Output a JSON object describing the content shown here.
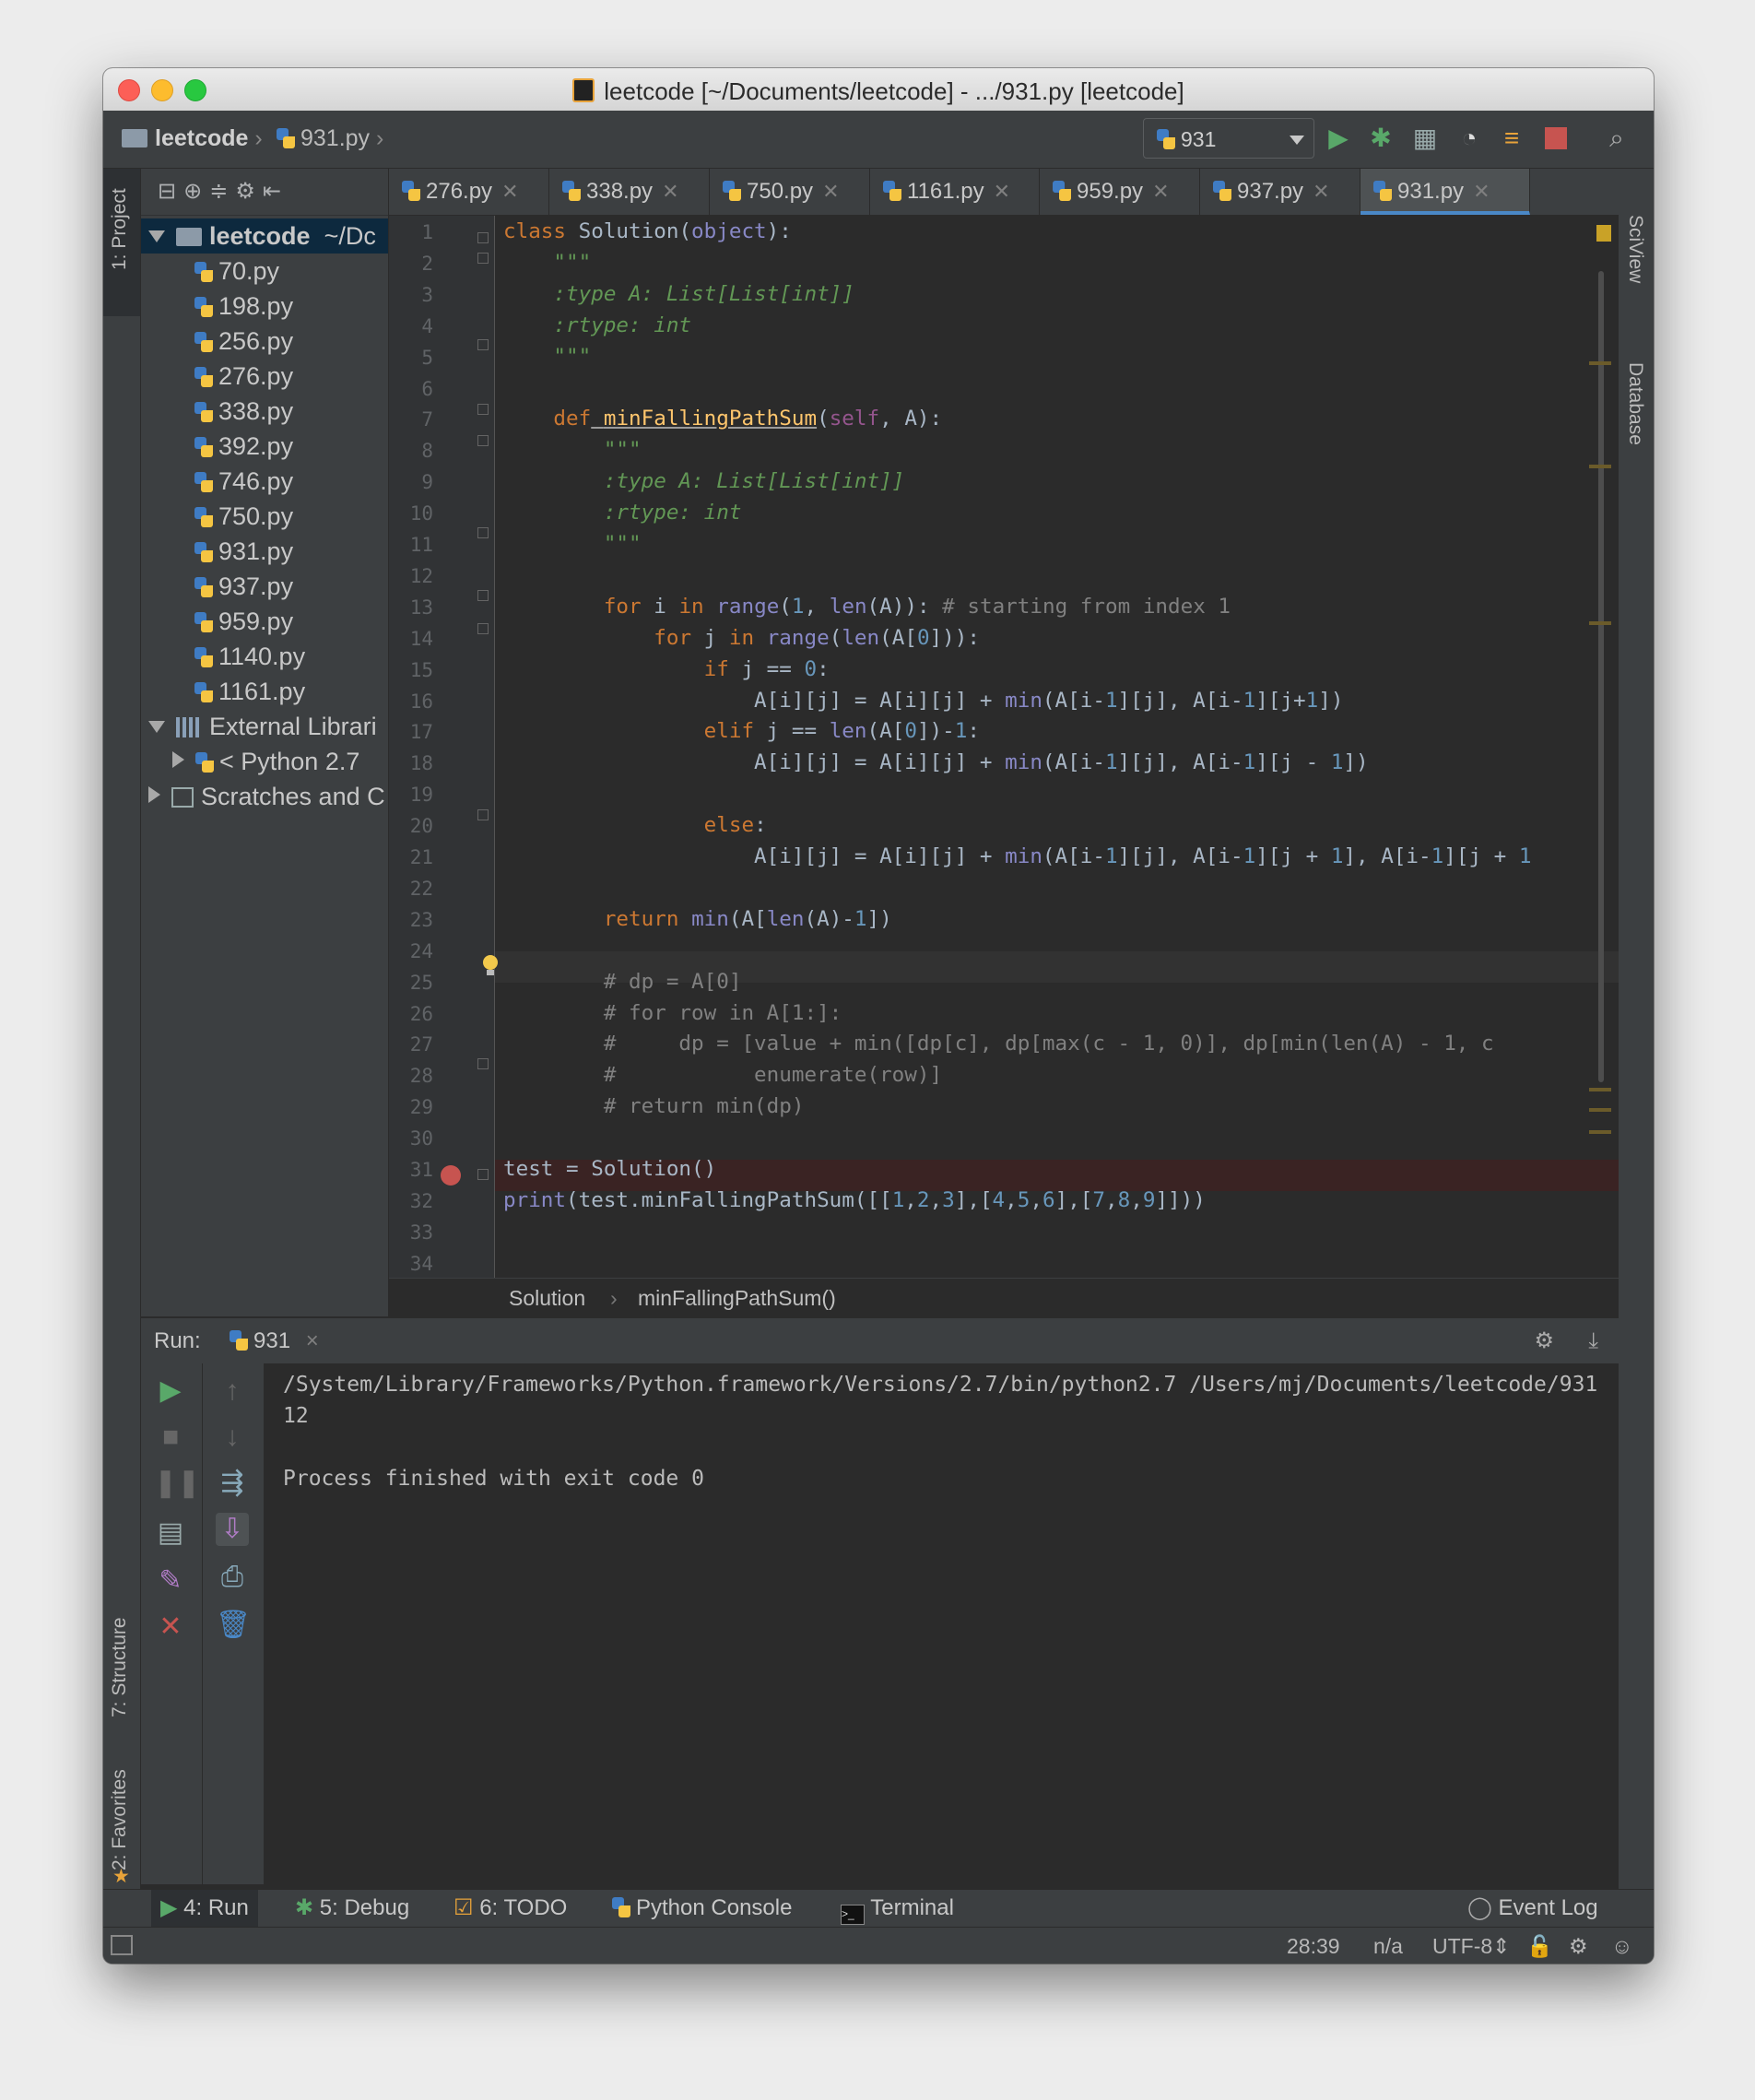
{
  "window": {
    "title": "leetcode [~/Documents/leetcode] - .../931.py [leetcode]"
  },
  "navbar": {
    "project_crumb": "leetcode",
    "file_crumb": "931.py",
    "run_config": "931"
  },
  "left_tool_tabs": {
    "project": "1: Project",
    "structure": "7: Structure",
    "favorites": "2: Favorites"
  },
  "right_tool_tabs": {
    "sciview": "SciView",
    "database": "Database"
  },
  "project_tree": {
    "root": "leetcode",
    "root_path": "~/Dc",
    "files": [
      "70.py",
      "198.py",
      "256.py",
      "276.py",
      "338.py",
      "392.py",
      "746.py",
      "750.py",
      "931.py",
      "937.py",
      "959.py",
      "1140.py",
      "1161.py"
    ],
    "external_libraries": "External Librari",
    "python_sdk": "< Python 2.7",
    "scratches": "Scratches and C"
  },
  "editor_tabs": [
    {
      "label": "276.py"
    },
    {
      "label": "338.py"
    },
    {
      "label": "750.py"
    },
    {
      "label": "1161.py"
    },
    {
      "label": "959.py"
    },
    {
      "label": "937.py"
    },
    {
      "label": "931.py",
      "active": true
    }
  ],
  "code": {
    "line_numbers": [
      "1",
      "2",
      "3",
      "4",
      "5",
      "6",
      "7",
      "8",
      "9",
      "10",
      "11",
      "12",
      "13",
      "14",
      "15",
      "16",
      "17",
      "18",
      "19",
      "20",
      "21",
      "22",
      "23",
      "24",
      "25",
      "26",
      "27",
      "28",
      "29",
      "30",
      "31",
      "32",
      "33",
      "34"
    ],
    "lines": [
      "class Solution(object):",
      "    \"\"\"",
      "    :type A: List[List[int]]",
      "    :rtype: int",
      "    \"\"\"",
      "",
      "    def minFallingPathSum(self, A):",
      "        \"\"\"",
      "        :type A: List[List[int]]",
      "        :rtype: int",
      "        \"\"\"",
      "",
      "        for i in range(1, len(A)): # starting from index 1",
      "            for j in range(len(A[0])):",
      "                if j == 0:",
      "                    A[i][j] = A[i][j] + min(A[i-1][j], A[i-1][j+1])",
      "                elif j == len(A[0])-1:",
      "                    A[i][j] = A[i][j] + min(A[i-1][j], A[i-1][j - 1])",
      "",
      "                else:",
      "                    A[i][j] = A[i][j] + min(A[i-1][j], A[i-1][j + 1], A[i-1][j + 1",
      "",
      "        return min(A[len(A)-1])",
      "",
      "        # dp = A[0]",
      "        # for row in A[1:]:",
      "        #     dp = [value + min([dp[c], dp[max(c - 1, 0)], dp[min(len(A) - 1, c",
      "        #           enumerate(row)]",
      "        # return min(dp)",
      "",
      "test = Solution()",
      "print(test.minFallingPathSum([[1,2,3],[4,5,6],[7,8,9]]))",
      "",
      ""
    ]
  },
  "editor_breadcrumb": {
    "class": "Solution",
    "method": "minFallingPathSum()"
  },
  "run_panel": {
    "label": "Run:",
    "tab": "931",
    "output": [
      "/System/Library/Frameworks/Python.framework/Versions/2.7/bin/python2.7 /Users/mj/Documents/leetcode/931",
      "12",
      "",
      "Process finished with exit code 0"
    ]
  },
  "bottom_tools": {
    "run": "4: Run",
    "debug": "5: Debug",
    "todo": "6: TODO",
    "python_console": "Python Console",
    "terminal": "Terminal",
    "event_log": "Event Log"
  },
  "statusbar": {
    "position": "28:39",
    "na": "n/a",
    "encoding": "UTF-8"
  },
  "colors": {
    "keyword": "#cc7832",
    "function": "#ffc66d",
    "builtin": "#8888c6",
    "number": "#6897bb",
    "comment": "#808080",
    "docstring": "#629755",
    "background": "#2b2b2b",
    "panel": "#3c3f41"
  }
}
